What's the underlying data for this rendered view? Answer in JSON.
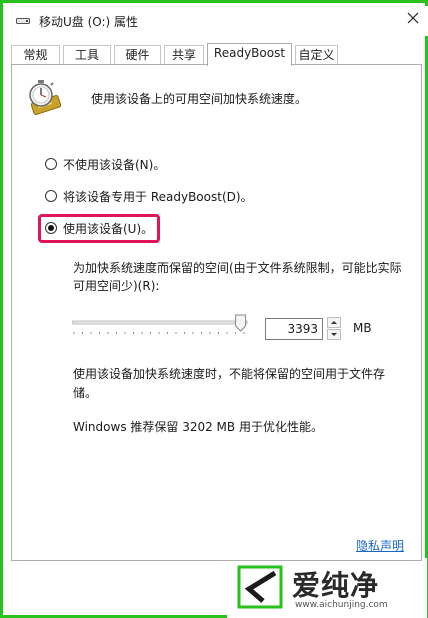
{
  "window": {
    "title": "移动U盘 (O:) 属性",
    "title_icon": "drive-icon",
    "close_icon": "close-icon"
  },
  "tabs": [
    {
      "label": "常规",
      "active": false
    },
    {
      "label": "工具",
      "active": false
    },
    {
      "label": "硬件",
      "active": false
    },
    {
      "label": "共享",
      "active": false
    },
    {
      "label": "ReadyBoost",
      "active": true
    },
    {
      "label": "自定义",
      "active": false
    }
  ],
  "readyboost": {
    "icon": "readyboost-stopwatch-icon",
    "intro": "使用该设备上的可用空间加快系统速度。",
    "options": [
      {
        "label": "不使用该设备(N)。",
        "checked": false
      },
      {
        "label": "将该设备专用于 ReadyBoost(D)。",
        "checked": false
      },
      {
        "label": "使用该设备(U)。",
        "checked": true
      }
    ],
    "highlight_color": "#e0145a",
    "reserve_label": "为加快系统速度而保留的空间(由于文件系统限制，可能比实际可用空间少)(R):",
    "slider_fraction": 0.98,
    "reserve_value": "3393",
    "reserve_unit": "MB",
    "warning": "使用该设备加快系统速度时，不能将保留的空间用于文件存储。",
    "recommendation": "Windows 推荐保留 3202 MB 用于优化性能。",
    "privacy_link": "隐私声明"
  },
  "watermark": {
    "brand": "爱纯净",
    "url": "www.aichunjing.com",
    "brand_color": "#27c31c"
  }
}
